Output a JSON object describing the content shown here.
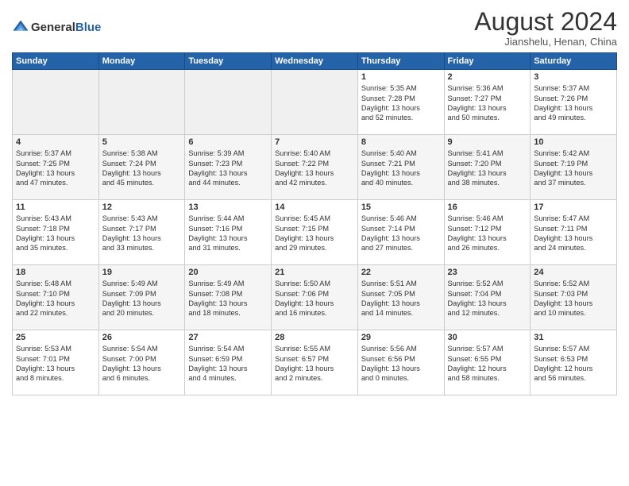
{
  "header": {
    "logo_general": "General",
    "logo_blue": "Blue",
    "month": "August 2024",
    "location": "Jianshelu, Henan, China"
  },
  "days_of_week": [
    "Sunday",
    "Monday",
    "Tuesday",
    "Wednesday",
    "Thursday",
    "Friday",
    "Saturday"
  ],
  "weeks": [
    [
      {
        "day": "",
        "info": ""
      },
      {
        "day": "",
        "info": ""
      },
      {
        "day": "",
        "info": ""
      },
      {
        "day": "",
        "info": ""
      },
      {
        "day": "1",
        "info": "Sunrise: 5:35 AM\nSunset: 7:28 PM\nDaylight: 13 hours\nand 52 minutes."
      },
      {
        "day": "2",
        "info": "Sunrise: 5:36 AM\nSunset: 7:27 PM\nDaylight: 13 hours\nand 50 minutes."
      },
      {
        "day": "3",
        "info": "Sunrise: 5:37 AM\nSunset: 7:26 PM\nDaylight: 13 hours\nand 49 minutes."
      }
    ],
    [
      {
        "day": "4",
        "info": "Sunrise: 5:37 AM\nSunset: 7:25 PM\nDaylight: 13 hours\nand 47 minutes."
      },
      {
        "day": "5",
        "info": "Sunrise: 5:38 AM\nSunset: 7:24 PM\nDaylight: 13 hours\nand 45 minutes."
      },
      {
        "day": "6",
        "info": "Sunrise: 5:39 AM\nSunset: 7:23 PM\nDaylight: 13 hours\nand 44 minutes."
      },
      {
        "day": "7",
        "info": "Sunrise: 5:40 AM\nSunset: 7:22 PM\nDaylight: 13 hours\nand 42 minutes."
      },
      {
        "day": "8",
        "info": "Sunrise: 5:40 AM\nSunset: 7:21 PM\nDaylight: 13 hours\nand 40 minutes."
      },
      {
        "day": "9",
        "info": "Sunrise: 5:41 AM\nSunset: 7:20 PM\nDaylight: 13 hours\nand 38 minutes."
      },
      {
        "day": "10",
        "info": "Sunrise: 5:42 AM\nSunset: 7:19 PM\nDaylight: 13 hours\nand 37 minutes."
      }
    ],
    [
      {
        "day": "11",
        "info": "Sunrise: 5:43 AM\nSunset: 7:18 PM\nDaylight: 13 hours\nand 35 minutes."
      },
      {
        "day": "12",
        "info": "Sunrise: 5:43 AM\nSunset: 7:17 PM\nDaylight: 13 hours\nand 33 minutes."
      },
      {
        "day": "13",
        "info": "Sunrise: 5:44 AM\nSunset: 7:16 PM\nDaylight: 13 hours\nand 31 minutes."
      },
      {
        "day": "14",
        "info": "Sunrise: 5:45 AM\nSunset: 7:15 PM\nDaylight: 13 hours\nand 29 minutes."
      },
      {
        "day": "15",
        "info": "Sunrise: 5:46 AM\nSunset: 7:14 PM\nDaylight: 13 hours\nand 27 minutes."
      },
      {
        "day": "16",
        "info": "Sunrise: 5:46 AM\nSunset: 7:12 PM\nDaylight: 13 hours\nand 26 minutes."
      },
      {
        "day": "17",
        "info": "Sunrise: 5:47 AM\nSunset: 7:11 PM\nDaylight: 13 hours\nand 24 minutes."
      }
    ],
    [
      {
        "day": "18",
        "info": "Sunrise: 5:48 AM\nSunset: 7:10 PM\nDaylight: 13 hours\nand 22 minutes."
      },
      {
        "day": "19",
        "info": "Sunrise: 5:49 AM\nSunset: 7:09 PM\nDaylight: 13 hours\nand 20 minutes."
      },
      {
        "day": "20",
        "info": "Sunrise: 5:49 AM\nSunset: 7:08 PM\nDaylight: 13 hours\nand 18 minutes."
      },
      {
        "day": "21",
        "info": "Sunrise: 5:50 AM\nSunset: 7:06 PM\nDaylight: 13 hours\nand 16 minutes."
      },
      {
        "day": "22",
        "info": "Sunrise: 5:51 AM\nSunset: 7:05 PM\nDaylight: 13 hours\nand 14 minutes."
      },
      {
        "day": "23",
        "info": "Sunrise: 5:52 AM\nSunset: 7:04 PM\nDaylight: 13 hours\nand 12 minutes."
      },
      {
        "day": "24",
        "info": "Sunrise: 5:52 AM\nSunset: 7:03 PM\nDaylight: 13 hours\nand 10 minutes."
      }
    ],
    [
      {
        "day": "25",
        "info": "Sunrise: 5:53 AM\nSunset: 7:01 PM\nDaylight: 13 hours\nand 8 minutes."
      },
      {
        "day": "26",
        "info": "Sunrise: 5:54 AM\nSunset: 7:00 PM\nDaylight: 13 hours\nand 6 minutes."
      },
      {
        "day": "27",
        "info": "Sunrise: 5:54 AM\nSunset: 6:59 PM\nDaylight: 13 hours\nand 4 minutes."
      },
      {
        "day": "28",
        "info": "Sunrise: 5:55 AM\nSunset: 6:57 PM\nDaylight: 13 hours\nand 2 minutes."
      },
      {
        "day": "29",
        "info": "Sunrise: 5:56 AM\nSunset: 6:56 PM\nDaylight: 13 hours\nand 0 minutes."
      },
      {
        "day": "30",
        "info": "Sunrise: 5:57 AM\nSunset: 6:55 PM\nDaylight: 12 hours\nand 58 minutes."
      },
      {
        "day": "31",
        "info": "Sunrise: 5:57 AM\nSunset: 6:53 PM\nDaylight: 12 hours\nand 56 minutes."
      }
    ]
  ]
}
